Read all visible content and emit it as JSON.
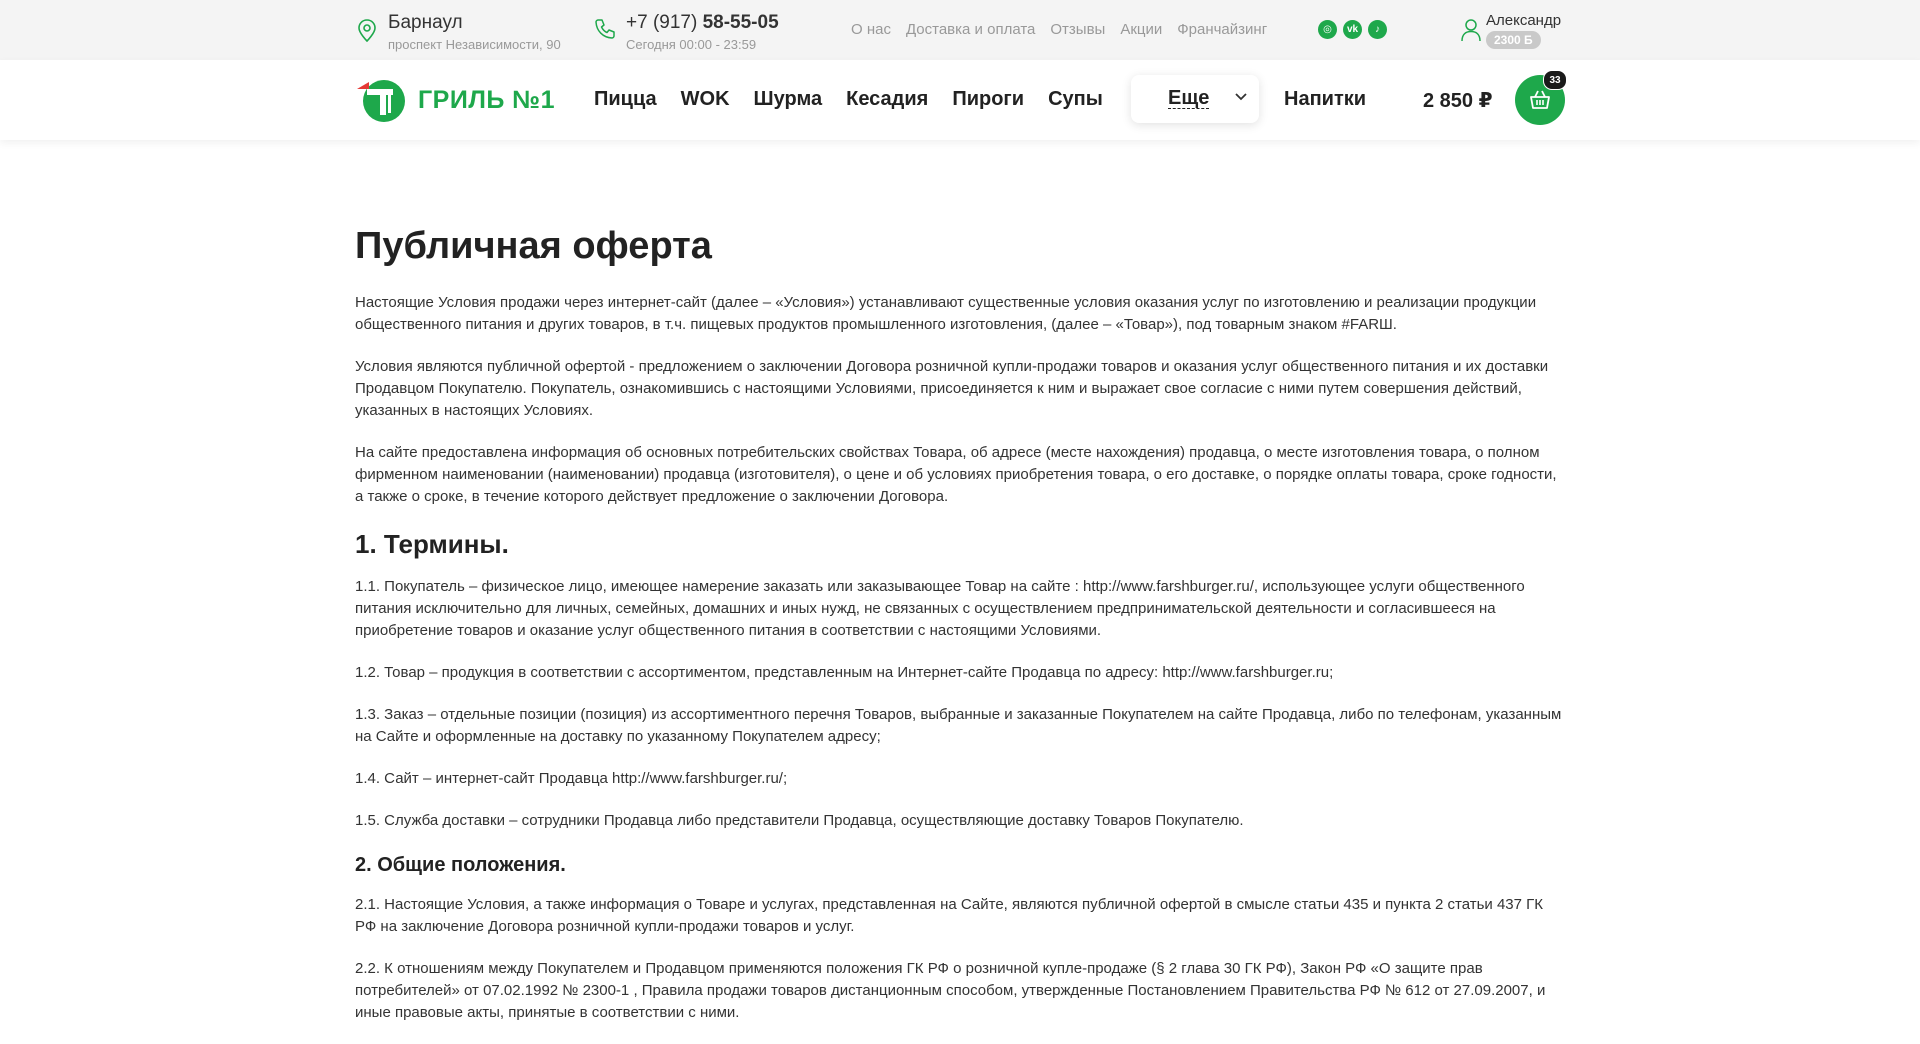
{
  "topbar": {
    "city": "Барнаул",
    "address": "проспект Независимости, 90",
    "phone_prefix": "+7 (917) ",
    "phone_number": "58-55-05",
    "hours": "Сегодня 00:00 - 23:59",
    "links": [
      "О нас",
      "Доставка и оплата",
      "Отзывы",
      "Акции",
      "Франчайзинг"
    ],
    "socials": [
      {
        "icon": "instagram-icon",
        "glyph": "◎"
      },
      {
        "icon": "vk-icon",
        "glyph": "vk"
      },
      {
        "icon": "tiktok-icon",
        "glyph": "♪"
      }
    ],
    "user_name": "Александр",
    "user_bonus": "2300 Б"
  },
  "nav": {
    "logo_text": "ГРИЛЬ №1",
    "items": [
      "Пицца",
      "WOK",
      "Шурма",
      "Кесадия",
      "Пироги",
      "Супы"
    ],
    "more_label": "Еще",
    "drinks_label": "Напитки",
    "cart_total": "2 850 ₽",
    "cart_count": "33"
  },
  "colors": {
    "accent": "#1ea84b",
    "logo_red": "#e53935"
  },
  "page": {
    "title": "Публичная оферта",
    "intro": [
      "Настоящие Условия продажи через интернет-сайт (далее – «Условия») устанавливают существенные условия оказания услуг по изготовлению и реализации продукции общественного питания и других товаров, в т.ч. пищевых продуктов промышленного изготовления, (далее – «Товар»), под товарным знаком #FARШ.",
      "Условия являются публичной офертой - предложением о заключении Договора розничной купли-продажи товаров и оказания услуг общественного питания и их доставки Продавцом Покупателю. Покупатель, ознакомившись с настоящими Условиями, присоединяется к ним и выражает свое согласие с ними путем совершения действий, указанных в настоящих Условиях.",
      "На сайте предоставлена информация об основных потребительских свойствах Товара, об адресе (месте нахождения) продавца, о месте изготовления товара, о полном фирменном наименовании (наименовании) продавца (изготовителя), о цене и об условиях приобретения товара, о его доставке, о порядке оплаты товара, сроке годности, а также о сроке, в течение которого действует предложение о заключении Договора."
    ],
    "section1_title": "1. Термины.",
    "section1": [
      "1.1. Покупатель – физическое лицо, имеющее намерение заказать или заказывающее Товар на сайте : http://www.farshburger.ru/, использующее услуги общественного питания исключительно для личных, семейных, домашних и иных нужд, не связанных с осуществлением предпринимательской деятельности и согласившееся на приобретение товаров и оказание услуг общественного питания в соответствии с настоящими Условиями.",
      "1.2. Товар – продукция в соответствии с ассортиментом, представленным на Интернет-сайте Продавца по адресу: http://www.farshburger.ru;",
      "1.3. Заказ – отдельные позиции (позиция) из ассортиментного перечня Товаров, выбранные и заказанные Покупателем на сайте Продавца, либо по телефонам, указанным на Сайте и оформленные на доставку по указанному Покупателем адресу;",
      "1.4. Сайт – интернет-сайт Продавца http://www.farshburger.ru/;",
      "1.5. Служба доставки – сотрудники Продавца либо представители Продавца, осуществляющие доставку Товаров Покупателю."
    ],
    "section2_title": "2. Общие положения.",
    "section2": [
      "2.1. Настоящие Условия, а также информация о Товаре и услугах, представленная на Сайте, являются публичной офертой в смысле статьи 435 и пункта 2 статьи 437 ГК РФ на заключение Договора розничной купли-продажи товаров и услуг.",
      "2.2. К отношениям между Покупателем и Продавцом применяются положения ГК РФ о розничной купле-продаже (§ 2 глава 30 ГК РФ), Закон РФ «О защите прав потребителей» от 07.02.1992 № 2300-1 , Правила продажи товаров дистанционным способом, утвержденные Постановлением Правительства РФ № 612 от 27.09.2007, и иные правовые акты, принятые в соответствии с ними."
    ]
  }
}
